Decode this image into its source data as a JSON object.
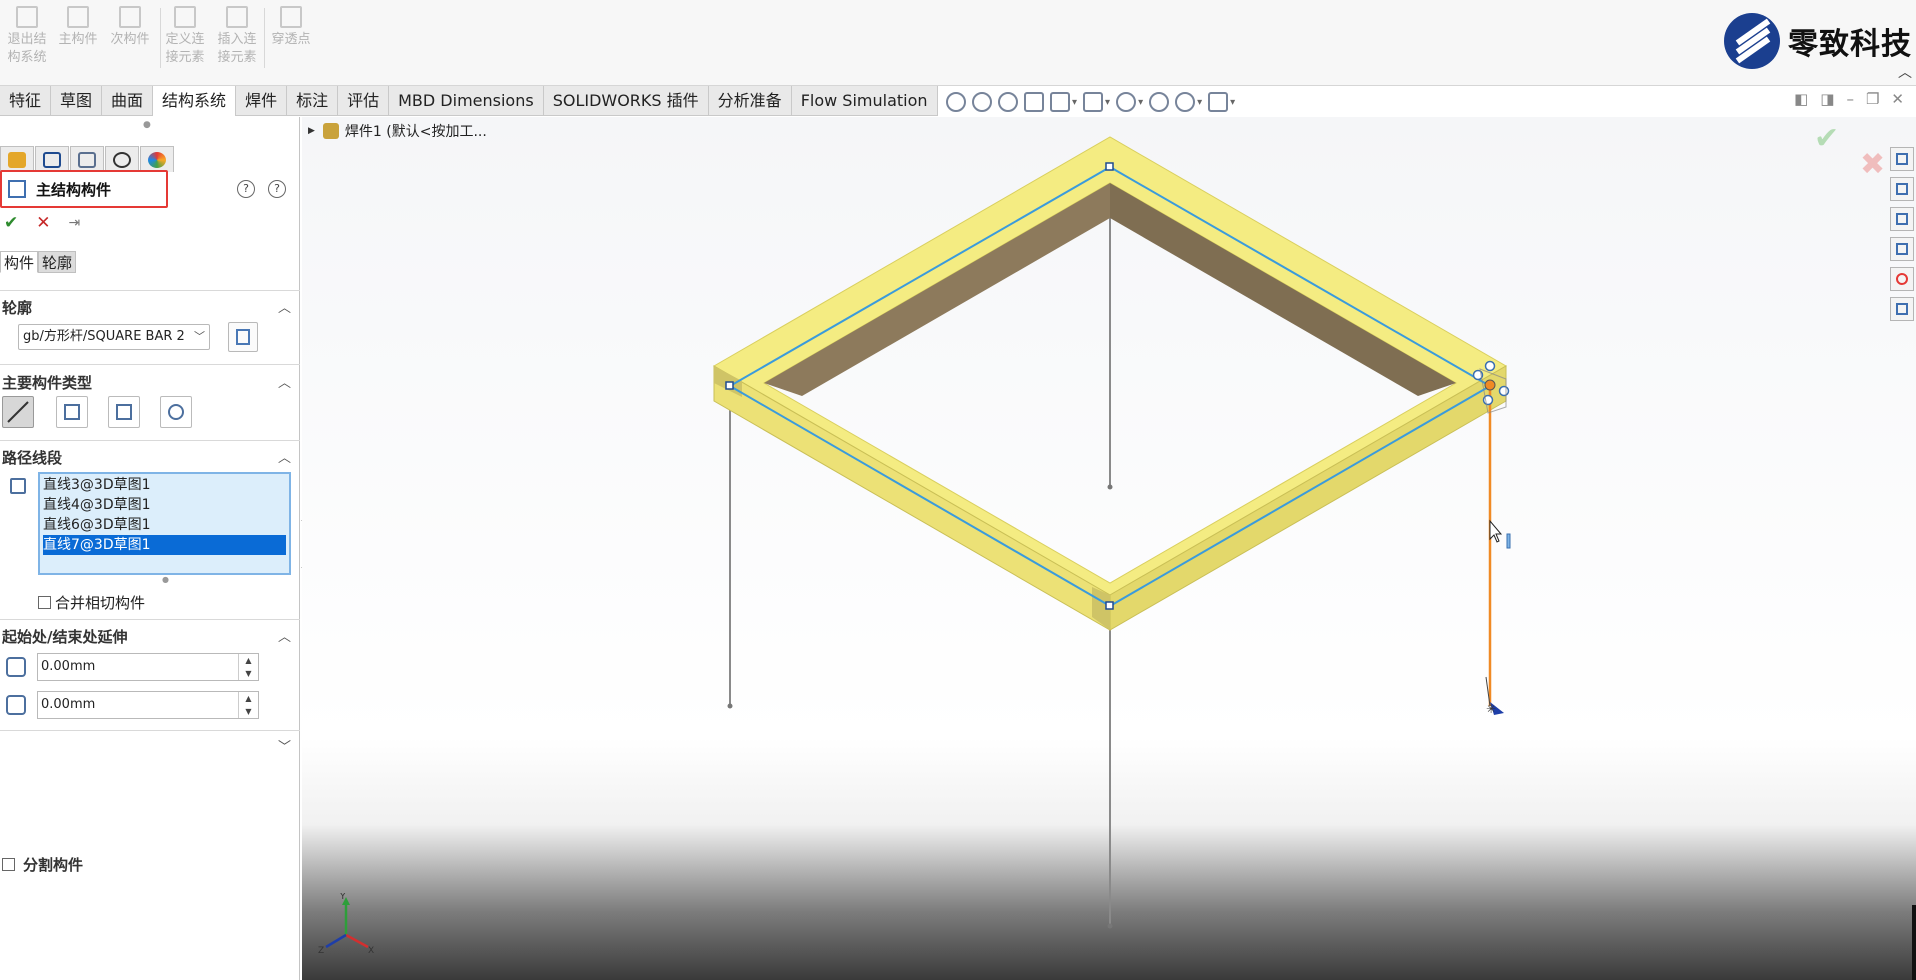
{
  "ribbon": {
    "buttons": [
      {
        "label": "退出结\n构系统"
      },
      {
        "label": "主构件"
      },
      {
        "label": "次构件"
      },
      {
        "label": "定义连\n接元素"
      },
      {
        "label": "插入连\n接元素"
      },
      {
        "label": "穿透点"
      }
    ],
    "logo_text": "零致科技"
  },
  "tabs": [
    "特征",
    "草图",
    "曲面",
    "结构系统",
    "焊件",
    "标注",
    "评估",
    "MBD Dimensions",
    "SOLIDWORKS 插件",
    "分析准备",
    "Flow Simulation"
  ],
  "active_tab": "结构系统",
  "panel": {
    "title": "主结构构件",
    "help_labels": [
      "?",
      "?"
    ],
    "ok": "✔",
    "cancel": "✕",
    "pin": "⇥",
    "subtabs": [
      "构件",
      "轮廓"
    ],
    "profile": {
      "header": "轮廓",
      "value": "gb/方形杆/SQUARE BAR 2"
    },
    "member_type": {
      "header": "主要构件类型"
    },
    "path": {
      "header": "路径线段",
      "items": [
        "直线3@3D草图1",
        "直线4@3D草图1",
        "直线6@3D草图1",
        "直线7@3D草图1"
      ],
      "selected_index": 3
    },
    "merge_label": "合并相切构件",
    "extend": {
      "header": "起始处/结束处延伸",
      "start": "0.00mm",
      "end": "0.00mm"
    },
    "split_label": "分割构件"
  },
  "viewport": {
    "tree_label": "焊件1 (默认<按加工...",
    "confirm": "✔",
    "cancel": "✖"
  },
  "colors": {
    "accent": "#0a6bd6",
    "frame_top": "#f4ec82",
    "frame_side": "#8d7a5c",
    "sketch_line": "#3a9bdc",
    "selected_path": "#f08a24",
    "highlight_box": "#e53935"
  }
}
